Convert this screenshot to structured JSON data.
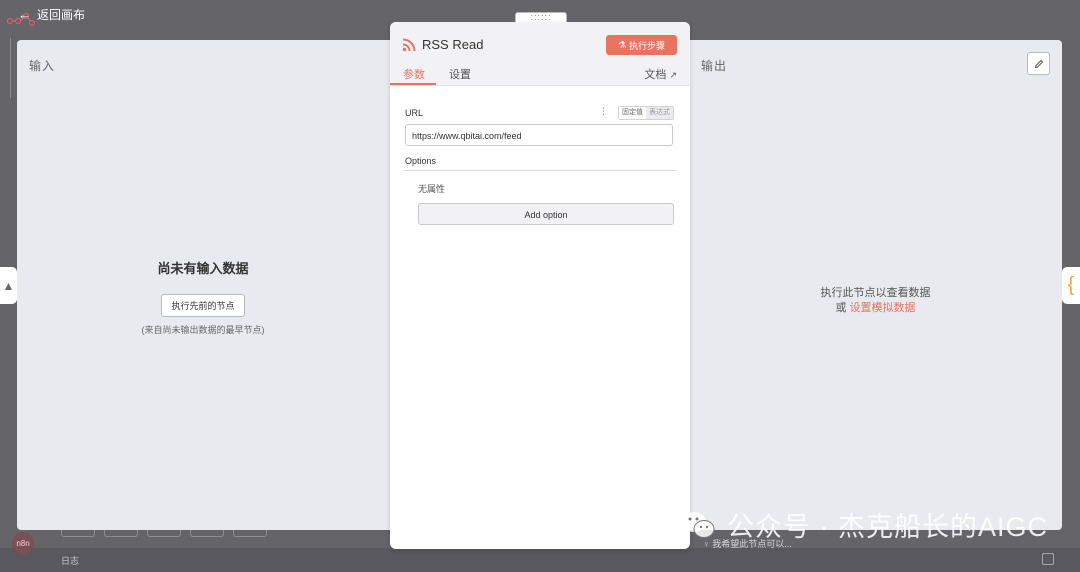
{
  "top": {
    "back_label": "返回画布"
  },
  "input_pane": {
    "title": "输入",
    "empty_headline": "尚未有输入数据",
    "exec_prev_label": "执行先前的节点",
    "hint": "(来自尚未输出数据的最早节点)"
  },
  "node": {
    "title": "RSS Read",
    "exec_step_label": "执行步骤",
    "tabs": {
      "params": "参数",
      "settings": "设置"
    },
    "docs_label": "文档",
    "url_label": "URL",
    "mode_fixed": "固定值",
    "mode_expression": "表达式",
    "url_value": "https://www.qbitai.com/feed",
    "options_label": "Options",
    "no_props": "无属性",
    "add_option_label": "Add option"
  },
  "output_pane": {
    "title": "输出",
    "empty_line1": "执行此节点以查看数据",
    "or_label": "或",
    "mock_link": "设置模拟数据"
  },
  "bottom": {
    "log_label": "日志",
    "assistant_hint": "我希望此节点可以..."
  },
  "watermark": {
    "text": "公众号 · 杰克船长的AIGC"
  },
  "colors": {
    "accent": "#e8735f",
    "panel_bg": "#e9eaf0",
    "overlay": "#646469"
  }
}
